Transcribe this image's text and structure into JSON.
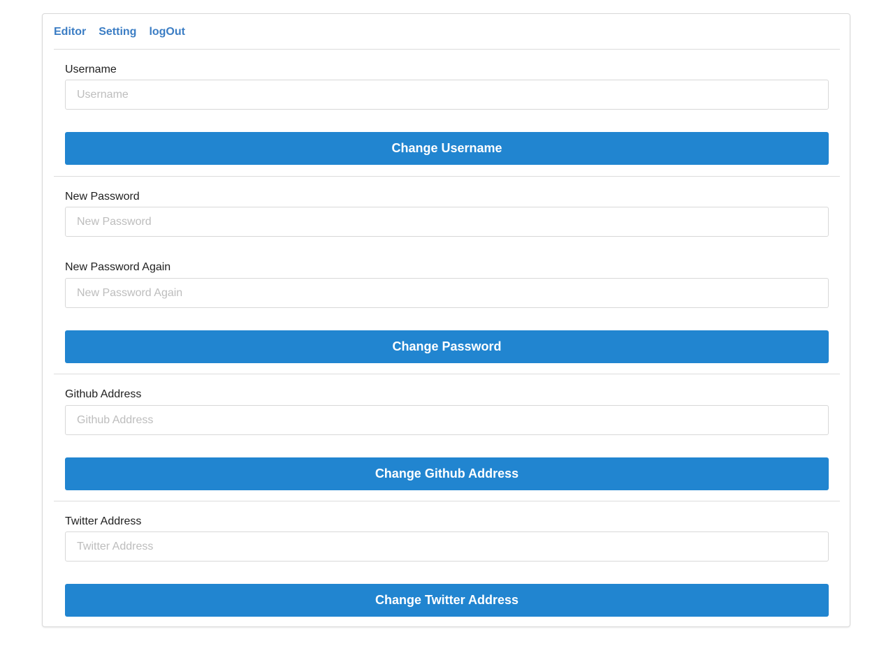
{
  "colors": {
    "link": "#3b7dc4",
    "button_bg": "#2185d0",
    "button_text": "#ffffff",
    "divider": "#dcdcdc"
  },
  "nav": {
    "editor": "Editor",
    "setting": "Setting",
    "logout": "logOut"
  },
  "username": {
    "label": "Username",
    "placeholder": "Username",
    "value": "",
    "button": "Change Username"
  },
  "password": {
    "new_label": "New Password",
    "new_placeholder": "New Password",
    "new_value": "",
    "again_label": "New Password Again",
    "again_placeholder": "New Password Again",
    "again_value": "",
    "button": "Change Password"
  },
  "github": {
    "label": "Github Address",
    "placeholder": "Github Address",
    "value": "",
    "button": "Change Github Address"
  },
  "twitter": {
    "label": "Twitter Address",
    "placeholder": "Twitter Address",
    "value": "",
    "button": "Change Twitter Address"
  }
}
